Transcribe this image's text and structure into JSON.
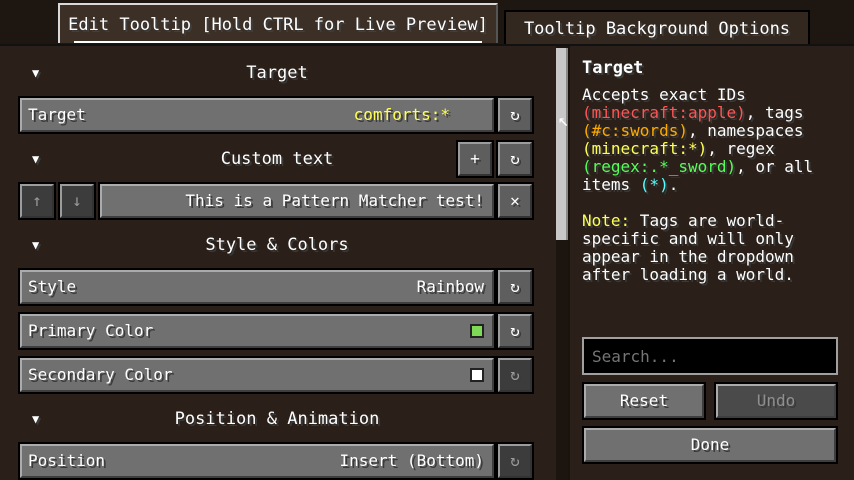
{
  "tabs": [
    {
      "label": "Edit Tooltip [Hold CTRL for Live Preview]",
      "active": true
    },
    {
      "label": "Tooltip Background Options",
      "active": false
    }
  ],
  "sections": {
    "target": "Target",
    "custom_text": "Custom text",
    "style_colors": "Style & Colors",
    "position_animation": "Position & Animation"
  },
  "rows": {
    "target": {
      "label": "Target",
      "value": "comforts:*",
      "value_color": "#ffff55"
    },
    "pattern_text": "This is a Pattern Matcher test!",
    "style": {
      "label": "Style",
      "value": "Rainbow"
    },
    "primary_color": {
      "label": "Primary Color",
      "swatch": "#7ed957"
    },
    "secondary_color": {
      "label": "Secondary Color",
      "swatch": "#ffffff"
    },
    "position": {
      "label": "Position",
      "value": "Insert (Bottom)"
    }
  },
  "icons": {
    "reset": "↻",
    "add": "+",
    "up": "↑",
    "down": "↓",
    "close": "✕",
    "section_toggle": "▼"
  },
  "help": {
    "title": "Target",
    "line1": "Accepts exact IDs",
    "id_example": "(minecraft:apple)",
    "tags_word": ", tags",
    "tag_example": "(#c:swords)",
    "namespaces_word": ", namespaces",
    "ns_example": "(minecraft:*)",
    "regex_word": ", regex",
    "regex_example": "(regex:.*_sword)",
    "or_all": ", or all",
    "items_word": "items ",
    "all_example": "(*)",
    "period": ".",
    "note_label": "Note:",
    "note_text": " Tags are world-specific and will only appear in the dropdown after loading a world."
  },
  "search": {
    "placeholder": "Search..."
  },
  "buttons": {
    "reset": "Reset",
    "undo": "Undo",
    "done": "Done"
  }
}
